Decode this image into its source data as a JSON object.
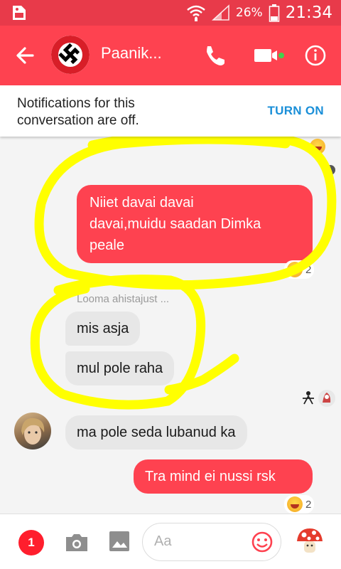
{
  "status_bar": {
    "battery_percent": "26%",
    "time": "21:34"
  },
  "header": {
    "title": "Paanik...",
    "online": true,
    "colors": {
      "bar": "#fe4250",
      "status": "#e83a4a"
    }
  },
  "notice": {
    "text_line1": "Notifications for this",
    "text_line2": "conversation are off.",
    "action": "TURN ON"
  },
  "messages": {
    "m1_line1": "Niiet davai davai",
    "m1_line2": "davai,muidu saadan Dimka",
    "m1_line3": "peale",
    "m1_reaction_count": "2",
    "typing_text": "Looma ahistajust ...",
    "m2": "mis asja",
    "m3": "mul pole raha",
    "m4": "ma pole seda lubanud ka",
    "m5": "Tra mind ei nussi rsk",
    "m5_reaction_count": "2"
  },
  "composer": {
    "badge_count": "1",
    "placeholder": "Aa"
  }
}
